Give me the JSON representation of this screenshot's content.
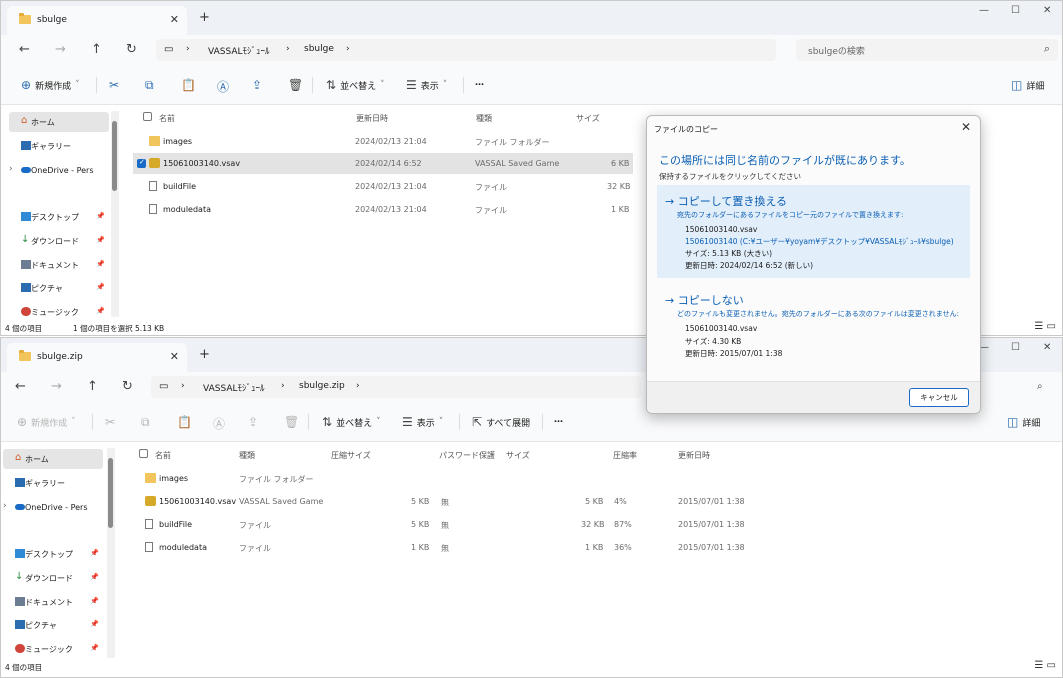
{
  "window1": {
    "tab_title": "sbulge",
    "path": [
      "VASSALﾓｼﾞｭｰﾙ",
      "sbulge"
    ],
    "search_placeholder": "sbulgeの検索",
    "toolbar": {
      "new": "新規作成",
      "sort": "並べ替え",
      "view": "表示",
      "more": "…",
      "details": "詳細"
    },
    "columns": {
      "name": "名前",
      "date": "更新日時",
      "type": "種類",
      "size": "サイズ"
    },
    "files": [
      {
        "name": "images",
        "date": "2024/02/13 21:04",
        "type": "ファイル フォルダー",
        "size": "",
        "icon": "folder-icon"
      },
      {
        "name": "15061003140.vsav",
        "date": "2024/02/14 6:52",
        "type": "VASSAL Saved Game",
        "size": "6 KB",
        "icon": "vassal-file-icon"
      },
      {
        "name": "buildFile",
        "date": "2024/02/13 21:04",
        "type": "ファイル",
        "size": "32 KB",
        "icon": "file-icon"
      },
      {
        "name": "moduledata",
        "date": "2024/02/13 21:04",
        "type": "ファイル",
        "size": "1 KB",
        "icon": "file-icon"
      }
    ],
    "status_items": "4 個の項目",
    "status_selected": "1 個の項目を選択  5.13 KB"
  },
  "sidebar": {
    "items": [
      {
        "label": "ホーム",
        "icon": "home-icon"
      },
      {
        "label": "ギャラリー",
        "icon": "gallery-icon"
      },
      {
        "label": "OneDrive - Pers",
        "icon": "onedrive-icon"
      },
      {
        "label": "デスクトップ",
        "icon": "desktop-icon"
      },
      {
        "label": "ダウンロード",
        "icon": "download-icon"
      },
      {
        "label": "ドキュメント",
        "icon": "documents-icon"
      },
      {
        "label": "ピクチャ",
        "icon": "pictures-icon"
      },
      {
        "label": "ミュージック",
        "icon": "music-icon"
      }
    ]
  },
  "window2": {
    "tab_title": "sbulge.zip",
    "path": [
      "VASSALﾓｼﾞｭｰﾙ",
      "sbulge.zip"
    ],
    "toolbar": {
      "new": "新規作成",
      "sort": "並べ替え",
      "view": "表示",
      "extract_all": "すべて展開",
      "more": "…",
      "details": "詳細"
    },
    "columns": {
      "name": "名前",
      "type": "種類",
      "compressed": "圧縮サイズ",
      "password": "パスワード保護",
      "size": "サイズ",
      "ratio": "圧縮率",
      "date": "更新日時"
    },
    "files": [
      {
        "name": "images",
        "type": "ファイル フォルダー",
        "compressed": "",
        "password": "",
        "size": "",
        "ratio": "",
        "date": "",
        "icon": "folder-icon"
      },
      {
        "name": "15061003140.vsav",
        "type": "VASSAL Saved Game",
        "compressed": "5 KB",
        "password": "無",
        "size": "5 KB",
        "ratio": "4%",
        "date": "2015/07/01 1:38",
        "icon": "vassal-file-icon"
      },
      {
        "name": "buildFile",
        "type": "ファイル",
        "compressed": "5 KB",
        "password": "無",
        "size": "32 KB",
        "ratio": "87%",
        "date": "2015/07/01 1:38",
        "icon": "file-icon"
      },
      {
        "name": "moduledata",
        "type": "ファイル",
        "compressed": "1 KB",
        "password": "無",
        "size": "1 KB",
        "ratio": "36%",
        "date": "2015/07/01 1:38",
        "icon": "file-icon"
      }
    ],
    "status_items": "4 個の項目"
  },
  "dialog": {
    "title": "ファイルのコピー",
    "heading": "この場所には同じ名前のファイルが既にあります。",
    "subheading": "保持するファイルをクリックしてください",
    "replace": {
      "title": "→ コピーして置き換える",
      "desc": "宛先のフォルダーにあるファイルをコピー元のファイルで置き換えます:",
      "filename": "15061003140.vsav",
      "path": "15061003140 (C:¥ユーザー¥yoyam¥デスクトップ¥VASSALﾓｼﾞｭｰﾙ¥sbulge)",
      "size": "サイズ: 5.13 KB (大きい)",
      "date": "更新日時: 2024/02/14 6:52 (新しい)"
    },
    "skip": {
      "title": "→ コピーしない",
      "desc": "どのファイルも変更されません。宛先のフォルダーにある次のファイルは変更されません:",
      "filename": "15061003140.vsav",
      "size": "サイズ: 4.30 KB",
      "date": "更新日時: 2015/07/01 1:38"
    },
    "cancel": "キャンセル"
  }
}
